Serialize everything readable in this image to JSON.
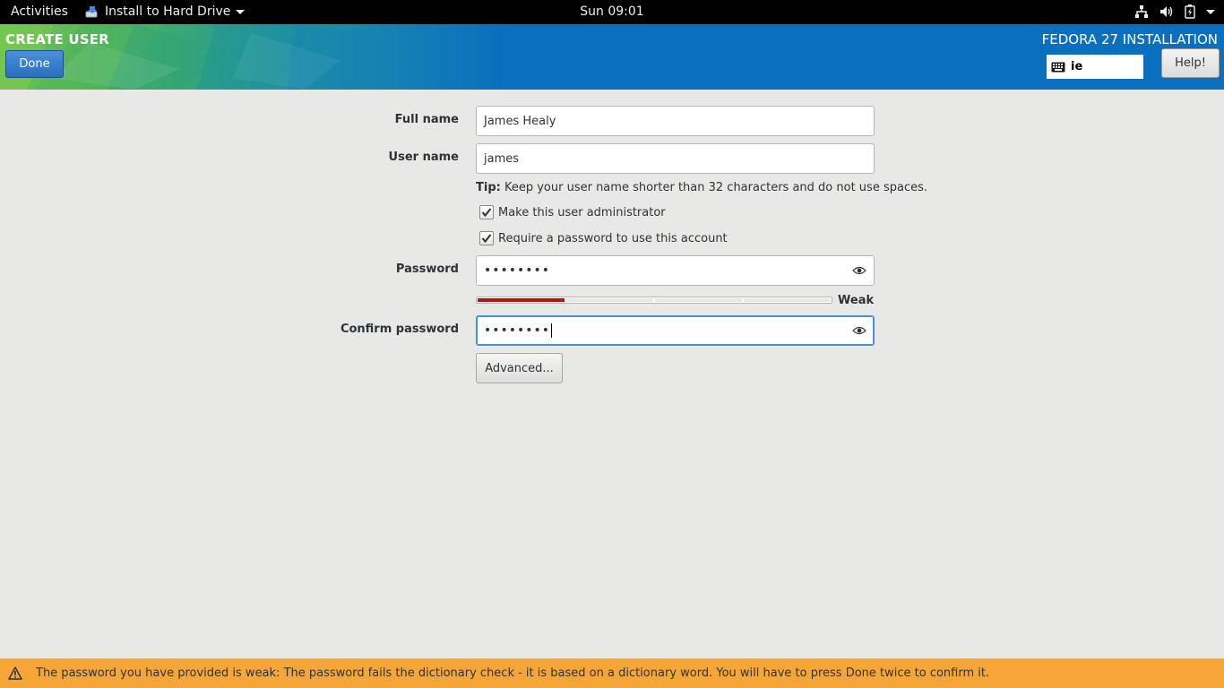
{
  "topbar": {
    "activities": "Activities",
    "app_name": "Install to Hard Drive",
    "clock": "Sun 09:01"
  },
  "header": {
    "spoke_title": "CREATE USER",
    "done_label": "Done",
    "install_title": "FEDORA 27 INSTALLATION",
    "keyboard_layout": "ie",
    "help_label": "Help!",
    "brand_color": "#0b6fc0"
  },
  "form": {
    "full_name": {
      "label": "Full name",
      "value": "James Healy"
    },
    "user_name": {
      "label": "User name",
      "value": "james"
    },
    "tip": {
      "prefix": "Tip:",
      "text": " Keep your user name shorter than 32 characters and do not use spaces."
    },
    "make_admin": {
      "label": "Make this user administrator",
      "checked": true
    },
    "require_password": {
      "label": "Require a password to use this account",
      "checked": true
    },
    "password": {
      "label": "Password",
      "masked": "••••••••"
    },
    "strength": {
      "label": "Weak",
      "level": 0.25,
      "color": "#b21414"
    },
    "confirm_password": {
      "label": "Confirm password",
      "masked": "••••••••"
    },
    "advanced_label": "Advanced..."
  },
  "warning": {
    "text": "The password you have provided is weak: The password fails the dictionary check - it is based on a dictionary word. You will have to press Done twice to confirm it.",
    "color": "#f5a637"
  }
}
